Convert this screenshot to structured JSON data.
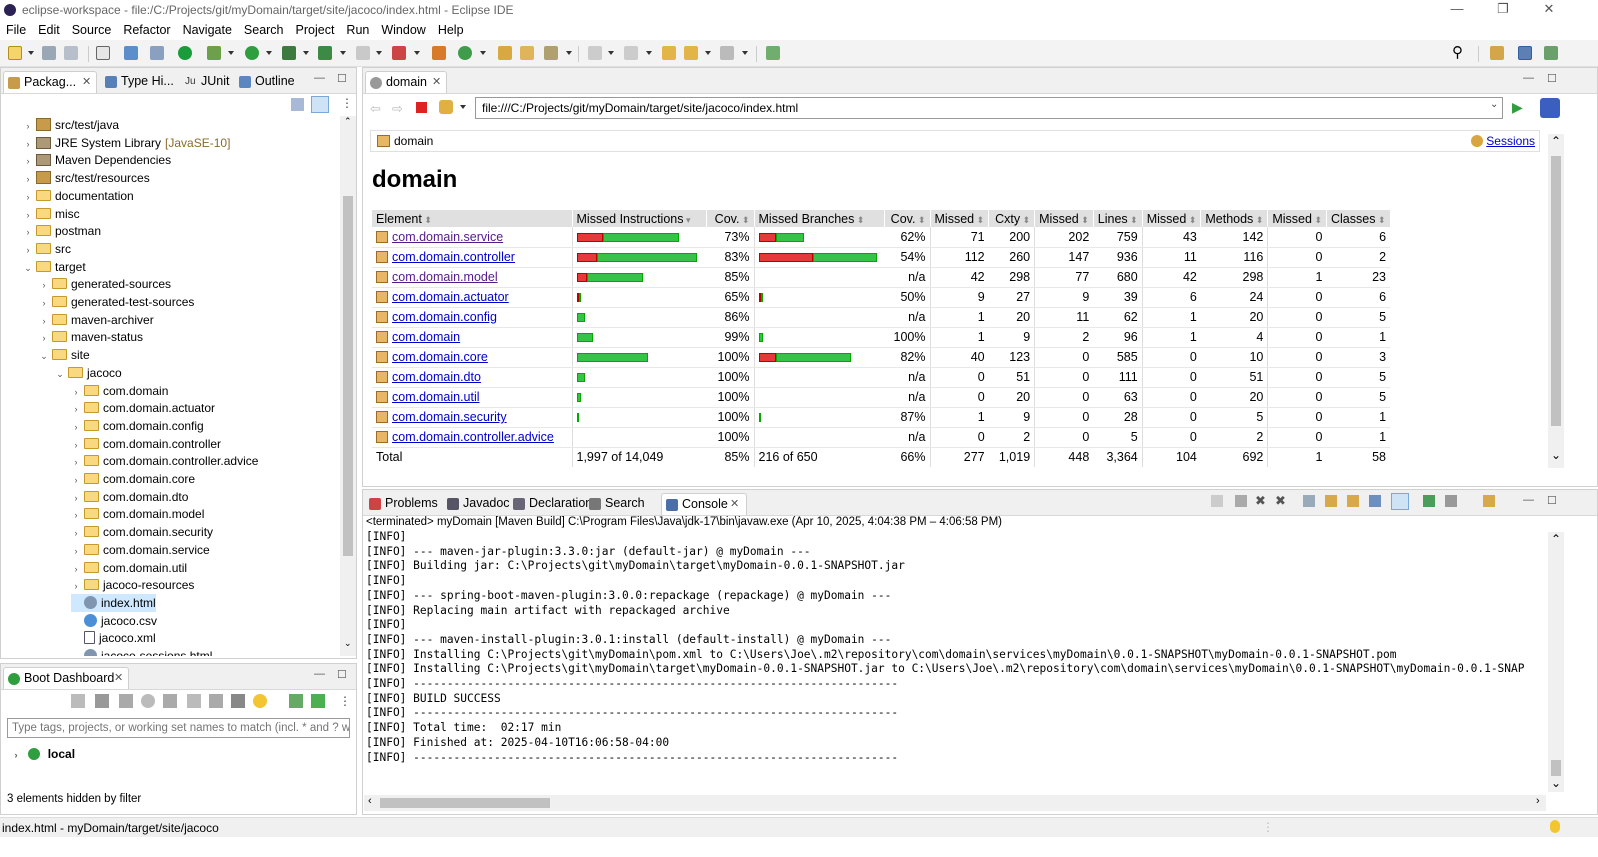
{
  "window": {
    "title": "eclipse-workspace - file:/C:/Projects/git/myDomain/target/site/jacoco/index.html - Eclipse IDE"
  },
  "menu": [
    "File",
    "Edit",
    "Source",
    "Refactor",
    "Navigate",
    "Search",
    "Project",
    "Run",
    "Window",
    "Help"
  ],
  "left_tabs": [
    "Packag...",
    "Type Hi...",
    "JUnit",
    "Outline"
  ],
  "tree": [
    {
      "label": "src/test/java",
      "icon": "package-icon",
      "level": 1,
      "arrow": "›"
    },
    {
      "label": "JRE System Library",
      "suffix": "[JavaSE-10]",
      "icon": "library-icon",
      "level": 1,
      "arrow": "›"
    },
    {
      "label": "Maven Dependencies",
      "icon": "library-icon",
      "level": 1,
      "arrow": "›"
    },
    {
      "label": "src/test/resources",
      "icon": "package-icon",
      "level": 1,
      "arrow": "›"
    },
    {
      "label": "documentation",
      "icon": "folder-icon",
      "level": 1,
      "arrow": "›"
    },
    {
      "label": "misc",
      "icon": "folder-icon",
      "level": 1,
      "arrow": "›"
    },
    {
      "label": "postman",
      "icon": "folder-icon",
      "level": 1,
      "arrow": "›"
    },
    {
      "label": "src",
      "icon": "folder-icon",
      "level": 1,
      "arrow": "›"
    },
    {
      "label": "target",
      "icon": "folder-icon",
      "level": 1,
      "arrow": "⌄"
    },
    {
      "label": "generated-sources",
      "icon": "folder-icon",
      "level": 2,
      "arrow": "›"
    },
    {
      "label": "generated-test-sources",
      "icon": "folder-icon",
      "level": 2,
      "arrow": "›"
    },
    {
      "label": "maven-archiver",
      "icon": "folder-icon",
      "level": 2,
      "arrow": "›"
    },
    {
      "label": "maven-status",
      "icon": "folder-icon",
      "level": 2,
      "arrow": "›"
    },
    {
      "label": "site",
      "icon": "folder-icon",
      "level": 2,
      "arrow": "⌄"
    },
    {
      "label": "jacoco",
      "icon": "folder-icon",
      "level": 3,
      "arrow": "⌄"
    },
    {
      "label": "com.domain",
      "icon": "folder-icon",
      "level": 4,
      "arrow": "›"
    },
    {
      "label": "com.domain.actuator",
      "icon": "folder-icon",
      "level": 4,
      "arrow": "›"
    },
    {
      "label": "com.domain.config",
      "icon": "folder-icon",
      "level": 4,
      "arrow": "›"
    },
    {
      "label": "com.domain.controller",
      "icon": "folder-icon",
      "level": 4,
      "arrow": "›"
    },
    {
      "label": "com.domain.controller.advice",
      "icon": "folder-icon",
      "level": 4,
      "arrow": "›"
    },
    {
      "label": "com.domain.core",
      "icon": "folder-icon",
      "level": 4,
      "arrow": "›"
    },
    {
      "label": "com.domain.dto",
      "icon": "folder-icon",
      "level": 4,
      "arrow": "›"
    },
    {
      "label": "com.domain.model",
      "icon": "folder-icon",
      "level": 4,
      "arrow": "›"
    },
    {
      "label": "com.domain.security",
      "icon": "folder-icon",
      "level": 4,
      "arrow": "›"
    },
    {
      "label": "com.domain.service",
      "icon": "folder-icon",
      "level": 4,
      "arrow": "›"
    },
    {
      "label": "com.domain.util",
      "icon": "folder-icon",
      "level": 4,
      "arrow": "›"
    },
    {
      "label": "jacoco-resources",
      "icon": "folder-icon",
      "level": 4,
      "arrow": "›"
    },
    {
      "label": "index.html",
      "icon": "html-file-icon",
      "level": 4,
      "arrow": "",
      "selected": true
    },
    {
      "label": "jacoco.csv",
      "icon": "csv-file-icon",
      "level": 4,
      "arrow": ""
    },
    {
      "label": "jacoco.xml",
      "icon": "xml-file-icon",
      "level": 4,
      "arrow": ""
    },
    {
      "label": "jacoco-sessions.html",
      "icon": "html-file-icon",
      "level": 4,
      "arrow": ""
    }
  ],
  "boot": {
    "tab": "Boot Dashboard",
    "filter_placeholder": "Type tags, projects, or working set names to match (incl. * and ? wildcards)",
    "item": "local",
    "hidden": "3 elements hidden by filter"
  },
  "browser": {
    "tab": "domain",
    "url": "file:///C:/Projects/git/myDomain/target/site/jacoco/index.html",
    "breadcrumb": "domain",
    "sessions": "Sessions",
    "heading": "domain"
  },
  "coverage": {
    "headers": [
      "Element",
      "Missed Instructions",
      "Cov.",
      "Missed Branches",
      "Cov.",
      "Missed",
      "Cxty",
      "Missed",
      "Lines",
      "Missed",
      "Methods",
      "Missed",
      "Classes"
    ],
    "rows": [
      {
        "name": "com.domain.service",
        "ins_red": 0.22,
        "ins_green": 0.63,
        "ins_cov": "73%",
        "br_red": 0.38,
        "br_green": 0.62,
        "br_len": 45,
        "br_cov": "62%",
        "mc": "71",
        "cx": "200",
        "ml": "202",
        "ln": "759",
        "mm": "43",
        "mt": "142",
        "mcl": "0",
        "cl": "6",
        "visited": true
      },
      {
        "name": "com.domain.controller",
        "ins_red": 0.17,
        "ins_green": 0.83,
        "ins_cov": "83%",
        "br_red": 0.46,
        "br_green": 0.54,
        "br_len": 118,
        "br_cov": "54%",
        "mc": "112",
        "cx": "260",
        "ml": "147",
        "ln": "936",
        "mm": "11",
        "mt": "116",
        "mcl": "0",
        "cl": "2",
        "visited": false
      },
      {
        "name": "com.domain.model",
        "ins_red": 0.08,
        "ins_green": 0.47,
        "ins_cov": "85%",
        "br_red": 0,
        "br_green": 0,
        "br_len": 0,
        "br_cov": "n/a",
        "mc": "42",
        "cx": "298",
        "ml": "77",
        "ln": "680",
        "mm": "42",
        "mt": "298",
        "mcl": "1",
        "cl": "23",
        "visited": true
      },
      {
        "name": "com.domain.actuator",
        "ins_red": 0.01,
        "ins_green": 0.02,
        "ins_cov": "65%",
        "br_red": 0.01,
        "br_green": 0.01,
        "br_len": 3,
        "br_cov": "50%",
        "mc": "9",
        "cx": "27",
        "ml": "9",
        "ln": "39",
        "mm": "6",
        "mt": "24",
        "mcl": "0",
        "cl": "6",
        "visited": false
      },
      {
        "name": "com.domain.config",
        "ins_red": 0,
        "ins_green": 0.07,
        "ins_cov": "86%",
        "br_red": 0,
        "br_green": 0,
        "br_len": 0,
        "br_cov": "n/a",
        "mc": "1",
        "cx": "20",
        "ml": "11",
        "ln": "62",
        "mm": "1",
        "mt": "20",
        "mcl": "0",
        "cl": "5",
        "visited": false
      },
      {
        "name": "com.domain",
        "ins_red": 0,
        "ins_green": 0.13,
        "ins_cov": "99%",
        "br_red": 0,
        "br_green": 0.04,
        "br_len": 4,
        "br_cov": "100%",
        "mc": "1",
        "cx": "9",
        "ml": "2",
        "ln": "96",
        "mm": "1",
        "mt": "4",
        "mcl": "0",
        "cl": "1",
        "visited": false
      },
      {
        "name": "com.domain.core",
        "ins_red": 0,
        "ins_green": 0.59,
        "ins_cov": "100%",
        "br_red": 0.18,
        "br_green": 0.82,
        "br_len": 92,
        "br_cov": "82%",
        "mc": "40",
        "cx": "123",
        "ml": "0",
        "ln": "585",
        "mm": "0",
        "mt": "10",
        "mcl": "0",
        "cl": "3",
        "visited": false
      },
      {
        "name": "com.domain.dto",
        "ins_red": 0,
        "ins_green": 0.07,
        "ins_cov": "100%",
        "br_red": 0,
        "br_green": 0,
        "br_len": 0,
        "br_cov": "n/a",
        "mc": "0",
        "cx": "51",
        "ml": "0",
        "ln": "111",
        "mm": "0",
        "mt": "51",
        "mcl": "0",
        "cl": "5",
        "visited": false
      },
      {
        "name": "com.domain.util",
        "ins_red": 0,
        "ins_green": 0.03,
        "ins_cov": "100%",
        "br_red": 0,
        "br_green": 0,
        "br_len": 0,
        "br_cov": "n/a",
        "mc": "0",
        "cx": "20",
        "ml": "0",
        "ln": "63",
        "mm": "0",
        "mt": "20",
        "mcl": "0",
        "cl": "5",
        "visited": false
      },
      {
        "name": "com.domain.security",
        "ins_red": 0,
        "ins_green": 0.01,
        "ins_cov": "100%",
        "br_red": 0,
        "br_green": 0.01,
        "br_len": 2,
        "br_cov": "87%",
        "mc": "1",
        "cx": "9",
        "ml": "0",
        "ln": "28",
        "mm": "0",
        "mt": "5",
        "mcl": "0",
        "cl": "1",
        "visited": false
      },
      {
        "name": "com.domain.controller.advice",
        "ins_red": 0,
        "ins_green": 0,
        "ins_cov": "100%",
        "br_red": 0,
        "br_green": 0,
        "br_len": 0,
        "br_cov": "n/a",
        "mc": "0",
        "cx": "2",
        "ml": "0",
        "ln": "5",
        "mm": "0",
        "mt": "2",
        "mcl": "0",
        "cl": "1",
        "visited": false
      }
    ],
    "total": {
      "name": "Total",
      "ins": "1,997 of 14,049",
      "ins_cov": "85%",
      "br": "216 of 650",
      "br_cov": "66%",
      "mc": "277",
      "cx": "1,019",
      "ml": "448",
      "ln": "3,364",
      "mm": "104",
      "mt": "692",
      "mcl": "1",
      "cl": "58"
    }
  },
  "bottom_tabs": [
    "Problems",
    "Javadoc",
    "Declaration",
    "Search",
    "Console"
  ],
  "console": {
    "header": "<terminated> myDomain [Maven Build] C:\\Program Files\\Java\\jdk-17\\bin\\javaw.exe  (Apr 10, 2025, 4:04:38 PM – 4:06:58 PM)",
    "lines": [
      "[INFO]",
      "[INFO] --- maven-jar-plugin:3.3.0:jar (default-jar) @ myDomain ---",
      "[INFO] Building jar: C:\\Projects\\git\\myDomain\\target\\myDomain-0.0.1-SNAPSHOT.jar",
      "[INFO]",
      "[INFO] --- spring-boot-maven-plugin:3.0.0:repackage (repackage) @ myDomain ---",
      "[INFO] Replacing main artifact with repackaged archive",
      "[INFO]",
      "[INFO] --- maven-install-plugin:3.0.1:install (default-install) @ myDomain ---",
      "[INFO] Installing C:\\Projects\\git\\myDomain\\pom.xml to C:\\Users\\Joe\\.m2\\repository\\com\\domain\\services\\myDomain\\0.0.1-SNAPSHOT\\myDomain-0.0.1-SNAPSHOT.pom",
      "[INFO] Installing C:\\Projects\\git\\myDomain\\target\\myDomain-0.0.1-SNAPSHOT.jar to C:\\Users\\Joe\\.m2\\repository\\com\\domain\\services\\myDomain\\0.0.1-SNAPSHOT\\myDomain-0.0.1-SNAP",
      "[INFO] ------------------------------------------------------------------------",
      "[INFO] BUILD SUCCESS",
      "[INFO] ------------------------------------------------------------------------",
      "[INFO] Total time:  02:17 min",
      "[INFO] Finished at: 2025-04-10T16:06:58-04:00",
      "[INFO] ------------------------------------------------------------------------"
    ]
  },
  "status": "index.html - myDomain/target/site/jacoco"
}
